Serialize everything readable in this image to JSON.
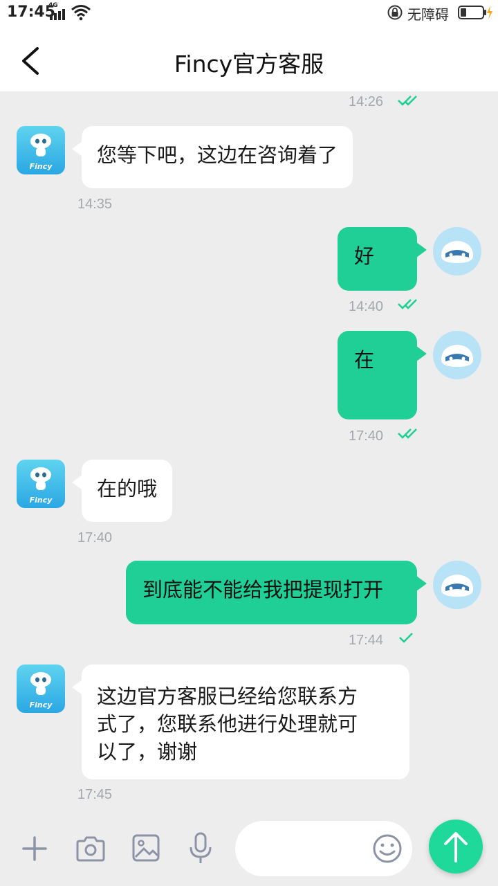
{
  "status_bar": {
    "time": "17:45",
    "network": "4G",
    "accessibility_label": "无障碍"
  },
  "header": {
    "title": "Fincy官方客服"
  },
  "colors": {
    "accent": "#1fcf95",
    "send_button": "#1fd99b",
    "background": "#ededed",
    "check": "#1fcf95"
  },
  "messages": [
    {
      "side": "right",
      "time": "14:26",
      "read": true
    },
    {
      "side": "left",
      "text": "您等下吧，这边在咨询着了",
      "time": "14:35"
    },
    {
      "side": "right",
      "text": "好",
      "time": "14:40",
      "read": true
    },
    {
      "side": "right",
      "text": "在",
      "time": "17:40",
      "read": true
    },
    {
      "side": "left",
      "text": "在的哦",
      "time": "17:40"
    },
    {
      "side": "right",
      "text": "到底能不能给我把提现打开",
      "time": "17:44",
      "read": false
    },
    {
      "side": "left",
      "text_lines": [
        "这边官方客服已经给您联系方",
        "式了，您联系他进行处理就可",
        "以了，谢谢"
      ],
      "time": "17:45"
    }
  ],
  "bot_avatar_logo": "Fincy",
  "toolbar": {
    "icons": [
      "plus-icon",
      "camera-icon",
      "image-icon",
      "microphone-icon"
    ],
    "emoji_icon": "emoji-icon",
    "send_icon": "arrow-up-icon"
  }
}
